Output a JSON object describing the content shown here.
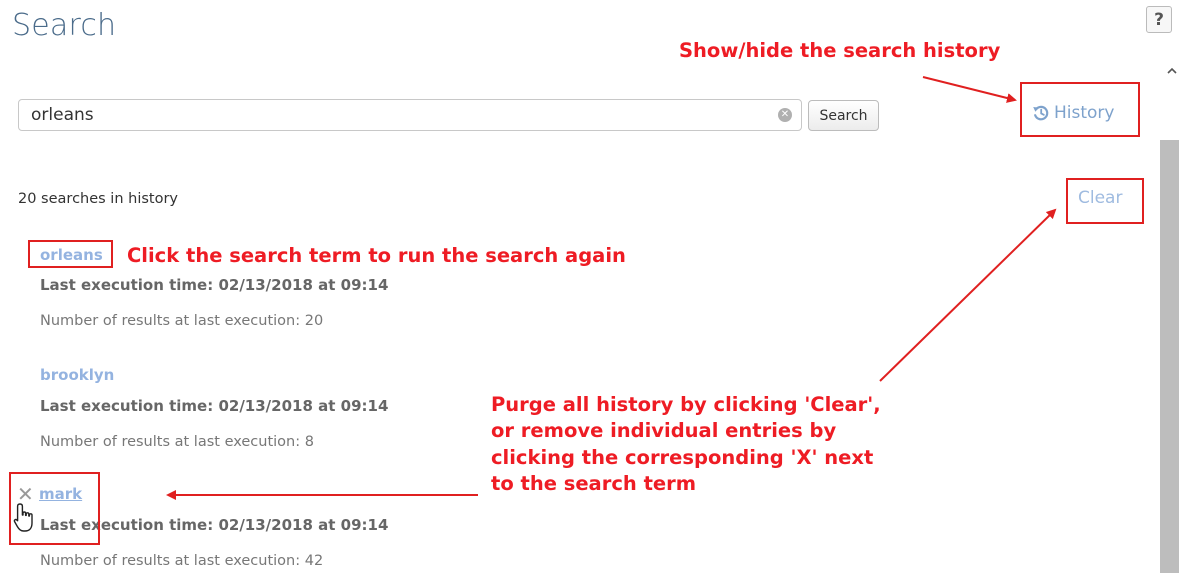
{
  "header": {
    "title": "Search",
    "help_label": "?"
  },
  "search": {
    "value": "orleans",
    "clear_glyph": "✕",
    "button_label": "Search"
  },
  "history_toggle": {
    "label": "History",
    "icon": "history-icon"
  },
  "history": {
    "count_text": "20 searches in history",
    "clear_label": "Clear",
    "remove_glyph": "✕",
    "entries": [
      {
        "term": "orleans",
        "last_execution": "Last execution time: 02/13/2018 at 09:14",
        "results": "Number of results at last execution: 20"
      },
      {
        "term": "brooklyn",
        "last_execution": "Last execution time: 02/13/2018 at 09:14",
        "results": "Number of results at last execution: 8"
      },
      {
        "term": "mark",
        "last_execution": "Last execution time: 02/13/2018 at 09:14",
        "results": "Number of results at last execution: 42"
      }
    ]
  },
  "annotations": {
    "history": "Show/hide the search history",
    "click_term": "Click the search term to run the search again",
    "purge_lines": [
      "Purge all history by clicking 'Clear',",
      "or remove individual entries by",
      "clicking the corresponding 'X' next",
      "to the search term"
    ]
  },
  "colors": {
    "title": "#4a6b8a",
    "link": "#94b3e0",
    "annotation": "#ee1c24",
    "scrollbar": "#bdbdbd"
  }
}
